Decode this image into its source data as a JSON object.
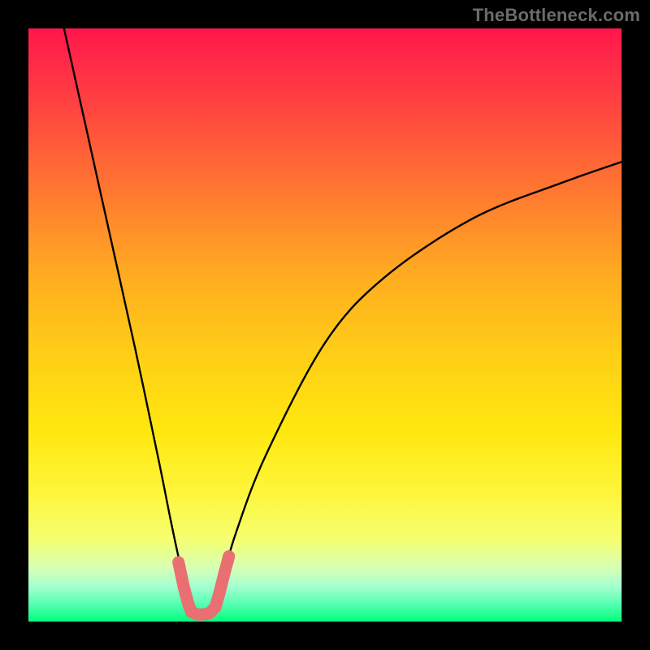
{
  "watermark": "TheBottleneck.com",
  "chart_data": {
    "type": "line",
    "title": "",
    "xlabel": "",
    "ylabel": "",
    "xlim": [
      0,
      100
    ],
    "ylim": [
      0,
      100
    ],
    "series": [
      {
        "name": "bottleneck-curve",
        "x": [
          6,
          10,
          14,
          18,
          22,
          24,
          25.5,
          27,
          28,
          29,
          30,
          31,
          32,
          33,
          35,
          40,
          50,
          60,
          75,
          90,
          100
        ],
        "y": [
          100,
          82,
          64,
          46,
          27,
          17,
          10,
          4,
          1.5,
          0.5,
          0.5,
          1.5,
          4,
          8,
          15,
          28,
          47,
          58,
          68,
          74,
          77.5
        ]
      }
    ],
    "highlight_segments": [
      {
        "name": "left-marker",
        "x": [
          25.3,
          26.2,
          27.0,
          27.5
        ],
        "y": [
          10.0,
          5.8,
          2.8,
          1.6
        ]
      },
      {
        "name": "base-marker",
        "x": [
          27.5,
          28.5,
          29.5,
          30.5,
          31.5
        ],
        "y": [
          1.6,
          1.2,
          1.2,
          1.4,
          2.4
        ]
      },
      {
        "name": "right-marker",
        "x": [
          31.5,
          32.2,
          33.0,
          33.8
        ],
        "y": [
          2.4,
          4.8,
          8.0,
          11.0
        ]
      }
    ],
    "gradient_stops": [
      {
        "pos": 0.0,
        "color": "#ff174a"
      },
      {
        "pos": 0.33,
        "color": "#ff8c2a"
      },
      {
        "pos": 0.68,
        "color": "#ffe80f"
      },
      {
        "pos": 0.91,
        "color": "#d6ffb6"
      },
      {
        "pos": 1.0,
        "color": "#00ff7e"
      }
    ],
    "highlight_color": "#e96f73",
    "curve_color": "#000000"
  }
}
